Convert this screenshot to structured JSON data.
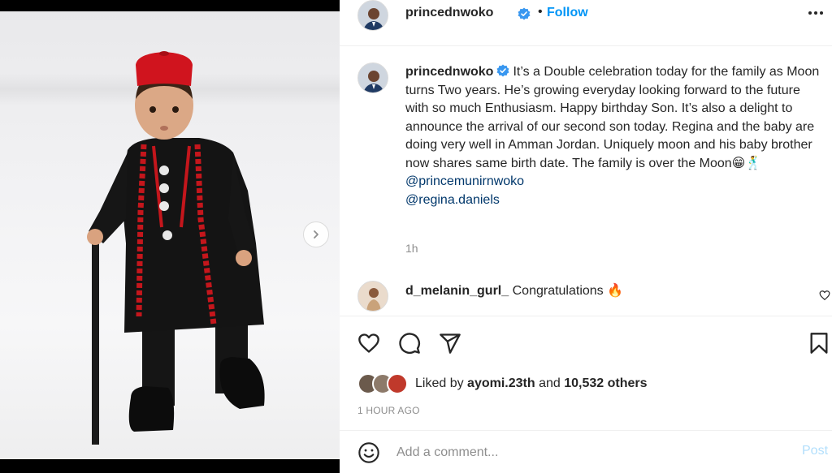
{
  "header": {
    "username": "princednwoko",
    "follow_label": "Follow",
    "separator": "•"
  },
  "caption": {
    "username": "princednwoko",
    "text": "It’s a Double celebration today for the family as Moon turns Two years. He’s growing everyday looking forward to the future with so much Enthusiasm. Happy birthday Son. It’s also a delight to announce the arrival of our second son today. Regina and the baby are doing very well in Amman Jordan. Uniquely moon and his baby brother now shares same birth date. The family is over the Moon😁🕺",
    "mentions": [
      "@princemunirnwoko",
      "@regina.daniels"
    ],
    "time": "1h"
  },
  "comments": [
    {
      "username": "d_melanin_gurl_",
      "text": "Congratulations 🔥"
    }
  ],
  "likes": {
    "prefix": "Liked by",
    "liker": "ayomi.23th",
    "joiner": "and",
    "others": "10,532 others"
  },
  "post_time": "1 HOUR AGO",
  "add_comment": {
    "placeholder": "Add a comment...",
    "post_label": "Post"
  },
  "icons": {
    "verified": "verified-badge-icon",
    "more": "more-options-icon",
    "like": "heart-icon",
    "comment": "comment-bubble-icon",
    "share": "paper-plane-icon",
    "save": "bookmark-icon",
    "emoji": "smiley-face-icon",
    "next": "chevron-right-icon"
  },
  "colors": {
    "link_blue": "#0095f6",
    "mention_blue": "#00376b",
    "muted": "#8e8e8e",
    "verified_blue": "#3897f0"
  }
}
